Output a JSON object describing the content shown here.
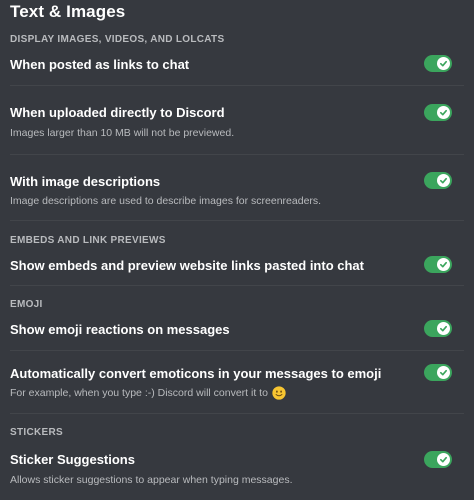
{
  "page": {
    "title": "Text & Images"
  },
  "sections": {
    "display": {
      "header": "DISPLAY IMAGES, VIDEOS, AND LOLCATS",
      "links": {
        "label": "When posted as links to chat",
        "enabled": true
      },
      "uploads": {
        "label": "When uploaded directly to Discord",
        "note": "Images larger than 10 MB will not be previewed.",
        "enabled": true
      },
      "descriptions": {
        "label": "With image descriptions",
        "note": "Image descriptions are used to describe images for screenreaders.",
        "enabled": true
      }
    },
    "embeds": {
      "header": "EMBEDS AND LINK PREVIEWS",
      "show_embeds": {
        "label": "Show embeds and preview website links pasted into chat",
        "enabled": true
      }
    },
    "emoji": {
      "header": "EMOJI",
      "reactions": {
        "label": "Show emoji reactions on messages",
        "enabled": true
      },
      "convert": {
        "label": "Automatically convert emoticons in your messages to emoji",
        "note": "For example, when you type :-) Discord will convert it to",
        "note_icon": "slightly-smiling-face-emoji",
        "enabled": true
      }
    },
    "stickers": {
      "header": "STICKERS",
      "suggestions": {
        "label": "Sticker Suggestions",
        "note": "Allows sticker suggestions to appear when typing messages.",
        "enabled": true
      }
    }
  },
  "colors": {
    "background": "#36393f",
    "toggle_on": "#3ba55d",
    "divider": "#42454a",
    "heading_text": "#ffffff",
    "muted_text": "#b9bbbe"
  },
  "icons": {
    "toggle_check": "check-icon",
    "emoji": "slightly-smiling-face-icon"
  }
}
